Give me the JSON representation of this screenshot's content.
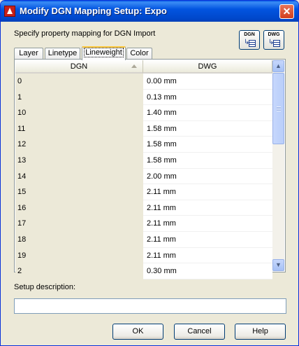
{
  "window": {
    "title": "Modify DGN Mapping Setup: Expo",
    "close_glyph": "✕"
  },
  "instruction": "Specify property mapping for DGN Import",
  "toolbar": {
    "dgn_button_caption": "DGN",
    "dwg_button_caption": "DWG"
  },
  "tabs": [
    {
      "label": "Layer",
      "active": false
    },
    {
      "label": "Linetype",
      "active": false
    },
    {
      "label": "Lineweight",
      "active": true
    },
    {
      "label": "Color",
      "active": false
    }
  ],
  "grid": {
    "columns": [
      "DGN",
      "DWG"
    ],
    "rows": [
      {
        "dgn": "0",
        "dwg": "0.00 mm"
      },
      {
        "dgn": "1",
        "dwg": "0.13 mm"
      },
      {
        "dgn": "10",
        "dwg": "1.40 mm"
      },
      {
        "dgn": "11",
        "dwg": "1.58 mm"
      },
      {
        "dgn": "12",
        "dwg": "1.58 mm"
      },
      {
        "dgn": "13",
        "dwg": "1.58 mm"
      },
      {
        "dgn": "14",
        "dwg": "2.00 mm"
      },
      {
        "dgn": "15",
        "dwg": "2.11 mm"
      },
      {
        "dgn": "16",
        "dwg": "2.11 mm"
      },
      {
        "dgn": "17",
        "dwg": "2.11 mm"
      },
      {
        "dgn": "18",
        "dwg": "2.11 mm"
      },
      {
        "dgn": "19",
        "dwg": "2.11 mm"
      },
      {
        "dgn": "2",
        "dwg": "0.30 mm"
      }
    ]
  },
  "description": {
    "label": "Setup description:",
    "value": ""
  },
  "buttons": {
    "ok": "OK",
    "cancel": "Cancel",
    "help": "Help"
  },
  "colors": {
    "title_bar": "#0255e0",
    "active_tab_accent": "#ffc83c",
    "dialog_face": "#ece9d8"
  }
}
